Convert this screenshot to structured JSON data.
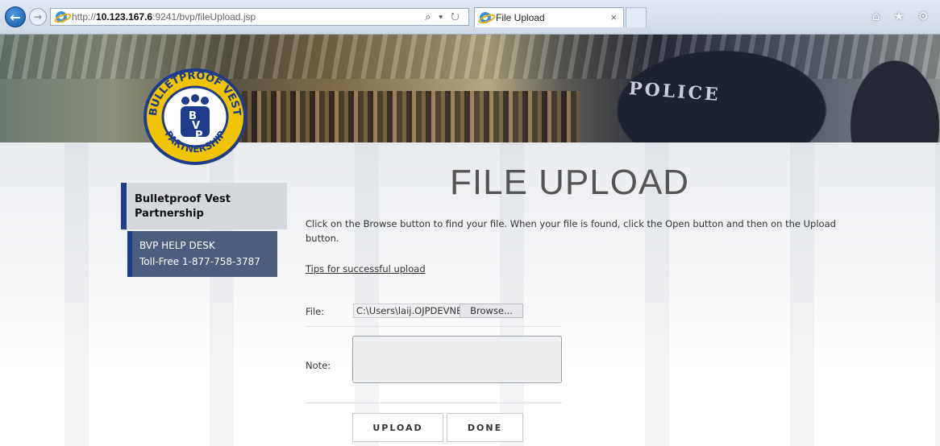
{
  "browser": {
    "url_prefix": "http://",
    "url_host": "10.123.167.6",
    "url_rest": ":9241/bvp/fileUpload.jsp",
    "address_tools": "⌕ ▾ ↻",
    "tab_title": "File Upload",
    "tab_close": "×",
    "chrome_icons": "⌂ ★ ⚙"
  },
  "banner": {
    "logo_top_text": "BULLETPROOF VEST",
    "logo_bottom_text": "PARTNERSHIP",
    "logo_letters": [
      "B",
      "V",
      "P"
    ],
    "police_text": "POLICE"
  },
  "sidebar": {
    "title": "Bulletproof Vest Partnership",
    "helpdesk_title": "BVP HELP DESK",
    "helpdesk_phone": "Toll-Free 1-877-758-3787"
  },
  "main": {
    "title": "FILE UPLOAD",
    "instructions": "Click on the Browse button to find your file. When your file is found, click the Open button and then on the Upload button.",
    "tips_link": "Tips for successful upload",
    "file_label": "File:",
    "file_value": "C:\\Users\\laij.OJPDEVNE",
    "browse_label": "Browse...",
    "note_label": "Note:",
    "note_value": "",
    "upload_label": "UPLOAD",
    "done_label": "DONE"
  },
  "colors": {
    "sidebar_accent": "#1d3c8c",
    "helpdesk_bg": "#4d5d80",
    "title_gray": "#555555"
  }
}
